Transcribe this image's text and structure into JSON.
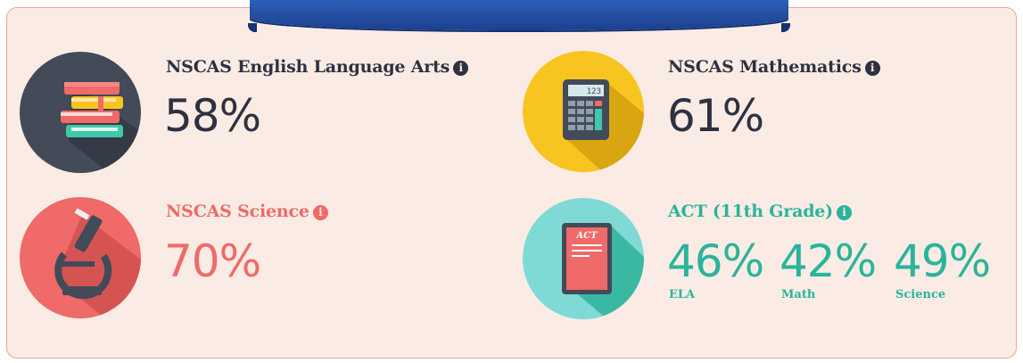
{
  "colors": {
    "dark": "#2d3140",
    "red": "#ef6a68",
    "yellow": "#f8c420",
    "teal": "#2bb39b",
    "ribbon": "#2355a8",
    "panel_bg": "#faece4"
  },
  "ela": {
    "title": "NSCAS English Language Arts",
    "value": "58%",
    "icon": "books-icon"
  },
  "math": {
    "title": "NSCAS Mathematics",
    "value": "61%",
    "icon": "calculator-icon",
    "display": "123"
  },
  "science": {
    "title": "NSCAS Science",
    "value": "70%",
    "icon": "microscope-icon"
  },
  "act": {
    "title": "ACT (11th Grade)",
    "icon": "act-book-icon",
    "book_label": "ACT",
    "scores": [
      {
        "value": "46%",
        "label": "ELA"
      },
      {
        "value": "42%",
        "label": "Math"
      },
      {
        "value": "49%",
        "label": "Science"
      }
    ]
  },
  "info_glyph": "i"
}
